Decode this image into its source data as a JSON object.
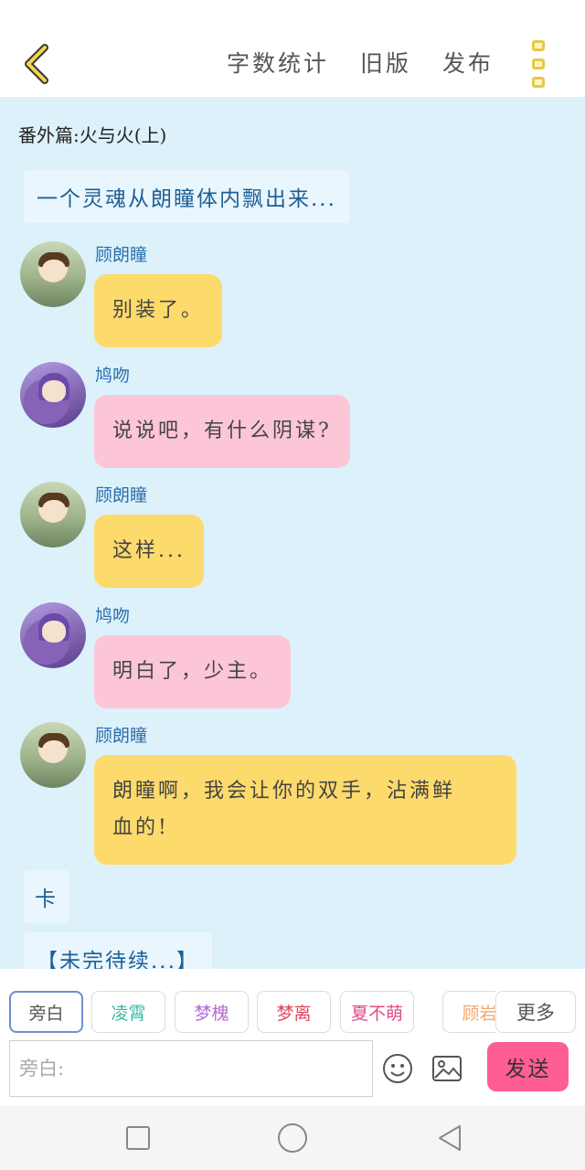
{
  "header": {
    "actions": [
      "字数统计",
      "旧版",
      "发布"
    ]
  },
  "chapter_title": "番外篇:火与火(上)",
  "narrations": {
    "intro": "一个灵魂从朗瞳体内飘出来...",
    "cut": "卡",
    "tbc": "【未完待续...】"
  },
  "messages": [
    {
      "name": "顾朗瞳",
      "text": "别装了。"
    },
    {
      "name": "鸠吻",
      "text": "说说吧，有什么阴谋?"
    },
    {
      "name": "顾朗瞳",
      "text": "这样..."
    },
    {
      "name": "鸠吻",
      "text": "明白了，少主。"
    },
    {
      "name": "顾朗瞳",
      "text_line1": "朗瞳啊，我会让你的双手，沾满鲜",
      "text_line2": "血的!"
    }
  ],
  "roles": [
    {
      "label": "旁白",
      "color": "#555555"
    },
    {
      "label": "凌霄",
      "color": "#3fb8a8"
    },
    {
      "label": "梦槐",
      "color": "#b46ad6"
    },
    {
      "label": "梦离",
      "color": "#e0455a"
    },
    {
      "label": "夏不萌",
      "color": "#e04a86"
    },
    {
      "label": "顾岩",
      "color": "#f0a870"
    }
  ],
  "more_label": "更多",
  "input": {
    "placeholder": "旁白:"
  },
  "send_label": "发送",
  "colors": {
    "chat_bg": "#ddf1fb",
    "yellow_bubble": "#fdda6c",
    "pink_bubble": "#fcc6d6",
    "send": "#ff5d95",
    "accent": "#e6c84a"
  }
}
